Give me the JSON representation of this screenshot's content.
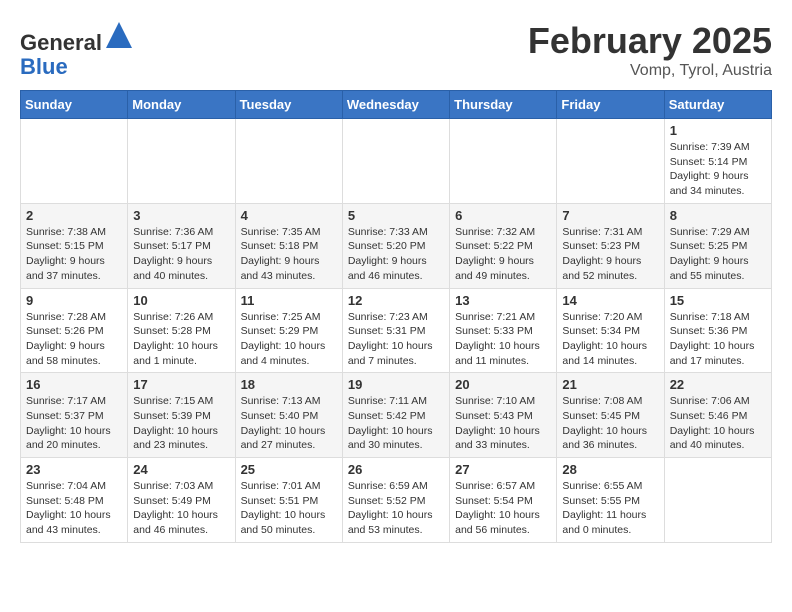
{
  "header": {
    "logo_general": "General",
    "logo_blue": "Blue",
    "month_title": "February 2025",
    "location": "Vomp, Tyrol, Austria"
  },
  "calendar": {
    "days_of_week": [
      "Sunday",
      "Monday",
      "Tuesday",
      "Wednesday",
      "Thursday",
      "Friday",
      "Saturday"
    ],
    "weeks": [
      [
        {
          "day": "",
          "info": ""
        },
        {
          "day": "",
          "info": ""
        },
        {
          "day": "",
          "info": ""
        },
        {
          "day": "",
          "info": ""
        },
        {
          "day": "",
          "info": ""
        },
        {
          "day": "",
          "info": ""
        },
        {
          "day": "1",
          "info": "Sunrise: 7:39 AM\nSunset: 5:14 PM\nDaylight: 9 hours and 34 minutes."
        }
      ],
      [
        {
          "day": "2",
          "info": "Sunrise: 7:38 AM\nSunset: 5:15 PM\nDaylight: 9 hours and 37 minutes."
        },
        {
          "day": "3",
          "info": "Sunrise: 7:36 AM\nSunset: 5:17 PM\nDaylight: 9 hours and 40 minutes."
        },
        {
          "day": "4",
          "info": "Sunrise: 7:35 AM\nSunset: 5:18 PM\nDaylight: 9 hours and 43 minutes."
        },
        {
          "day": "5",
          "info": "Sunrise: 7:33 AM\nSunset: 5:20 PM\nDaylight: 9 hours and 46 minutes."
        },
        {
          "day": "6",
          "info": "Sunrise: 7:32 AM\nSunset: 5:22 PM\nDaylight: 9 hours and 49 minutes."
        },
        {
          "day": "7",
          "info": "Sunrise: 7:31 AM\nSunset: 5:23 PM\nDaylight: 9 hours and 52 minutes."
        },
        {
          "day": "8",
          "info": "Sunrise: 7:29 AM\nSunset: 5:25 PM\nDaylight: 9 hours and 55 minutes."
        }
      ],
      [
        {
          "day": "9",
          "info": "Sunrise: 7:28 AM\nSunset: 5:26 PM\nDaylight: 9 hours and 58 minutes."
        },
        {
          "day": "10",
          "info": "Sunrise: 7:26 AM\nSunset: 5:28 PM\nDaylight: 10 hours and 1 minute."
        },
        {
          "day": "11",
          "info": "Sunrise: 7:25 AM\nSunset: 5:29 PM\nDaylight: 10 hours and 4 minutes."
        },
        {
          "day": "12",
          "info": "Sunrise: 7:23 AM\nSunset: 5:31 PM\nDaylight: 10 hours and 7 minutes."
        },
        {
          "day": "13",
          "info": "Sunrise: 7:21 AM\nSunset: 5:33 PM\nDaylight: 10 hours and 11 minutes."
        },
        {
          "day": "14",
          "info": "Sunrise: 7:20 AM\nSunset: 5:34 PM\nDaylight: 10 hours and 14 minutes."
        },
        {
          "day": "15",
          "info": "Sunrise: 7:18 AM\nSunset: 5:36 PM\nDaylight: 10 hours and 17 minutes."
        }
      ],
      [
        {
          "day": "16",
          "info": "Sunrise: 7:17 AM\nSunset: 5:37 PM\nDaylight: 10 hours and 20 minutes."
        },
        {
          "day": "17",
          "info": "Sunrise: 7:15 AM\nSunset: 5:39 PM\nDaylight: 10 hours and 23 minutes."
        },
        {
          "day": "18",
          "info": "Sunrise: 7:13 AM\nSunset: 5:40 PM\nDaylight: 10 hours and 27 minutes."
        },
        {
          "day": "19",
          "info": "Sunrise: 7:11 AM\nSunset: 5:42 PM\nDaylight: 10 hours and 30 minutes."
        },
        {
          "day": "20",
          "info": "Sunrise: 7:10 AM\nSunset: 5:43 PM\nDaylight: 10 hours and 33 minutes."
        },
        {
          "day": "21",
          "info": "Sunrise: 7:08 AM\nSunset: 5:45 PM\nDaylight: 10 hours and 36 minutes."
        },
        {
          "day": "22",
          "info": "Sunrise: 7:06 AM\nSunset: 5:46 PM\nDaylight: 10 hours and 40 minutes."
        }
      ],
      [
        {
          "day": "23",
          "info": "Sunrise: 7:04 AM\nSunset: 5:48 PM\nDaylight: 10 hours and 43 minutes."
        },
        {
          "day": "24",
          "info": "Sunrise: 7:03 AM\nSunset: 5:49 PM\nDaylight: 10 hours and 46 minutes."
        },
        {
          "day": "25",
          "info": "Sunrise: 7:01 AM\nSunset: 5:51 PM\nDaylight: 10 hours and 50 minutes."
        },
        {
          "day": "26",
          "info": "Sunrise: 6:59 AM\nSunset: 5:52 PM\nDaylight: 10 hours and 53 minutes."
        },
        {
          "day": "27",
          "info": "Sunrise: 6:57 AM\nSunset: 5:54 PM\nDaylight: 10 hours and 56 minutes."
        },
        {
          "day": "28",
          "info": "Sunrise: 6:55 AM\nSunset: 5:55 PM\nDaylight: 11 hours and 0 minutes."
        },
        {
          "day": "",
          "info": ""
        }
      ]
    ]
  }
}
